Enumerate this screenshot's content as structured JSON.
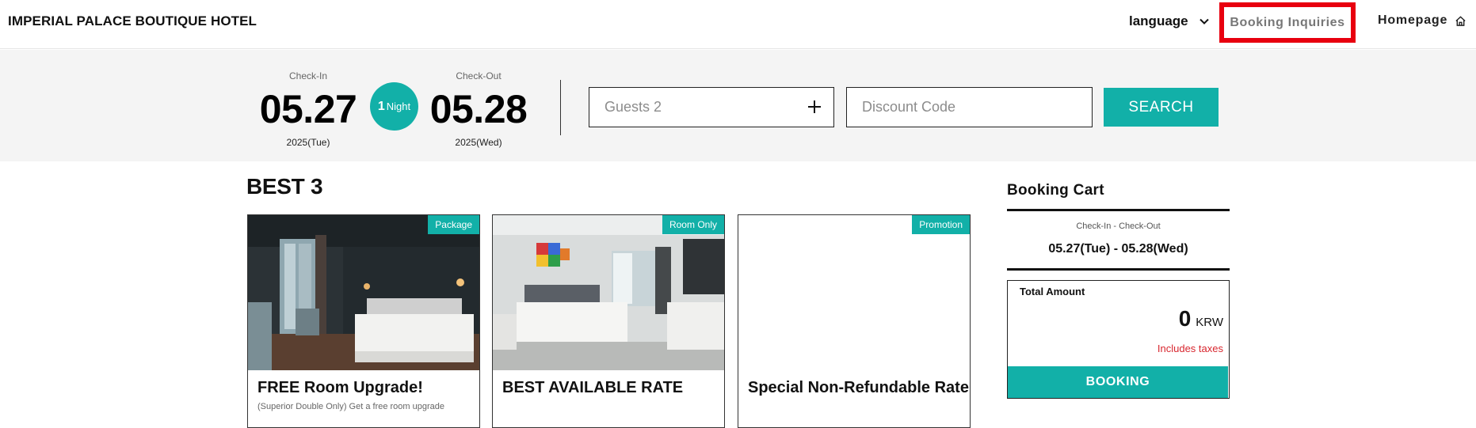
{
  "header": {
    "brand": "IMPERIAL PALACE BOUTIQUE HOTEL",
    "language_label": "language",
    "inquiries_label": "Booking Inquiries",
    "homepage_label": "Homepage"
  },
  "search": {
    "checkin_label": "Check-In",
    "checkin_date": "05.27",
    "checkin_sub": "2025(Tue)",
    "nights_count": "1",
    "nights_unit": "Night",
    "checkout_label": "Check-Out",
    "checkout_date": "05.28",
    "checkout_sub": "2025(Wed)",
    "guests_text": "Guests 2",
    "discount_placeholder": "Discount Code",
    "search_label": "SEARCH"
  },
  "best": {
    "heading": "BEST 3",
    "cards": [
      {
        "tag": "Package",
        "title": "FREE Room Upgrade!",
        "desc": "(Superior Double Only) Get a free room upgrade"
      },
      {
        "tag": "Room Only",
        "title": "BEST AVAILABLE RATE",
        "desc": ""
      },
      {
        "tag": "Promotion",
        "title": "Special Non-Refundable Rate",
        "desc": ""
      }
    ]
  },
  "cart": {
    "title": "Booking Cart",
    "range_label": "Check-In - Check-Out",
    "range_value": "05.27(Tue) - 05.28(Wed)",
    "total_label": "Total Amount",
    "total_value": "0",
    "currency": "KRW",
    "tax_note": "Includes taxes",
    "booking_label": "BOOKING"
  },
  "colors": {
    "accent": "#12b0a8",
    "highlight_border": "#e8000f",
    "tax_note": "#d8262e",
    "band_bg": "#f4f4f4"
  }
}
